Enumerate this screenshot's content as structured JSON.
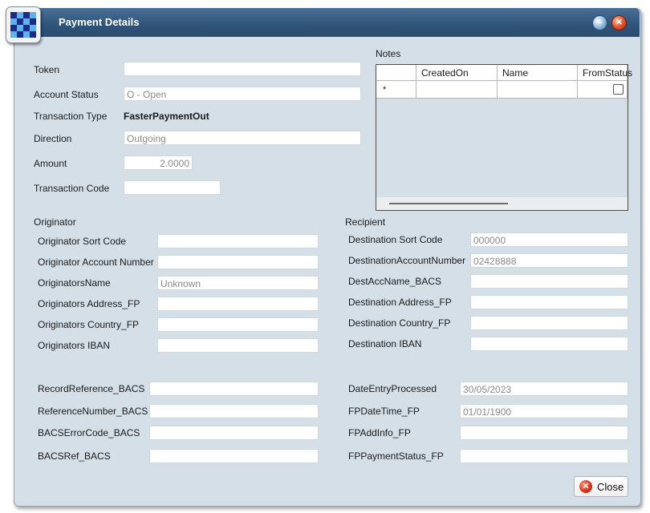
{
  "window": {
    "title": "Payment Details"
  },
  "colors": {
    "titlebar": "#2f5479",
    "body": "#d4dfe8",
    "field_text": "#8a8a8a"
  },
  "icons": {
    "app": "checker-icon",
    "minimize": "minimize-icon",
    "close": "close-icon"
  },
  "top": {
    "token": {
      "label": "Token",
      "value": ""
    },
    "account_status": {
      "label": "Account Status",
      "value": "O - Open"
    },
    "transaction_type": {
      "label": "Transaction Type",
      "value": "FasterPaymentOut"
    },
    "direction": {
      "label": "Direction",
      "value": "Outgoing"
    },
    "amount": {
      "label": "Amount",
      "value": "2.0000"
    },
    "transaction_code": {
      "label": "Transaction Code",
      "value": ""
    }
  },
  "notes": {
    "label": "Notes",
    "columns": [
      "CreatedOn",
      "Name",
      "FromStatus"
    ],
    "new_row_marker": "*"
  },
  "originator": {
    "heading": "Originator",
    "fields": [
      {
        "label": "Originator Sort Code",
        "value": ""
      },
      {
        "label": "Originator Account Number",
        "value": ""
      },
      {
        "label": "OriginatorsName",
        "value": "Unknown"
      },
      {
        "label": "Originators Address_FP",
        "value": ""
      },
      {
        "label": "Originators Country_FP",
        "value": ""
      },
      {
        "label": "Originators IBAN",
        "value": ""
      }
    ]
  },
  "recipient": {
    "heading": "Recipient",
    "fields": [
      {
        "label": "Destination Sort Code",
        "value": "000000"
      },
      {
        "label": "DestinationAccountNumber",
        "value": "02428888"
      },
      {
        "label": "DestAccName_BACS",
        "value": ""
      },
      {
        "label": "Destination Address_FP",
        "value": ""
      },
      {
        "label": "Destination Country_FP",
        "value": ""
      },
      {
        "label": "Destination IBAN",
        "value": ""
      }
    ]
  },
  "bacs": {
    "fields": [
      {
        "label": "RecordReference_BACS",
        "value": ""
      },
      {
        "label": "ReferenceNumber_BACS",
        "value": ""
      },
      {
        "label": "BACSErrorCode_BACS",
        "value": ""
      },
      {
        "label": "BACSRef_BACS",
        "value": ""
      }
    ]
  },
  "fp": {
    "fields": [
      {
        "label": "DateEntryProcessed",
        "value": "30/05/2023"
      },
      {
        "label": "FPDateTime_FP",
        "value": "01/01/1900"
      },
      {
        "label": "FPAddInfo_FP",
        "value": ""
      },
      {
        "label": "FPPaymentStatus_FP",
        "value": ""
      }
    ]
  },
  "footer": {
    "close_label": "Close"
  }
}
